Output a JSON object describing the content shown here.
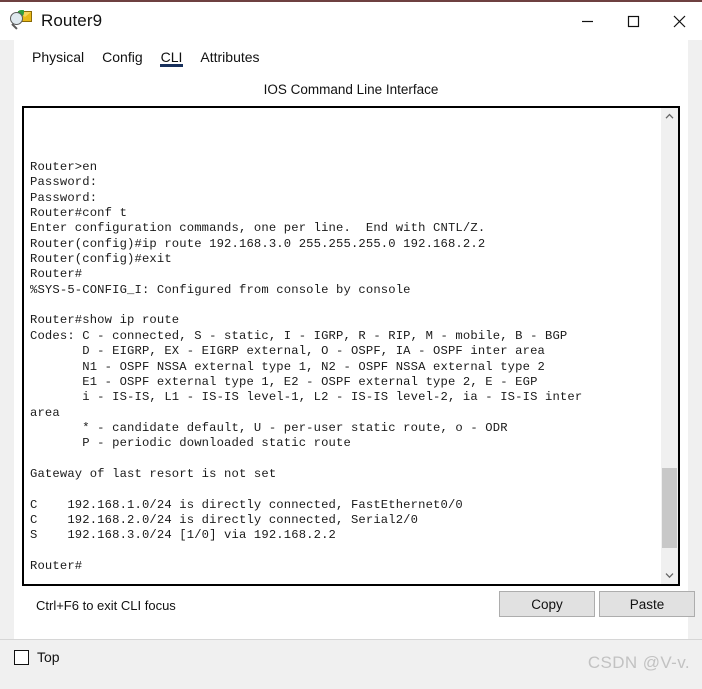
{
  "window": {
    "title": "Router9",
    "icon": "router-magnifier-icon",
    "controls": {
      "minimize": "minimize-icon",
      "maximize": "maximize-icon",
      "close": "close-icon"
    }
  },
  "tabs": [
    {
      "label": "Physical",
      "active": false
    },
    {
      "label": "Config",
      "active": false
    },
    {
      "label": "CLI",
      "active": true
    },
    {
      "label": "Attributes",
      "active": false
    }
  ],
  "panel": {
    "title": "IOS Command Line Interface"
  },
  "terminal": {
    "content": "\n\n\nRouter>en\nPassword:\nPassword:\nRouter#conf t\nEnter configuration commands, one per line.  End with CNTL/Z.\nRouter(config)#ip route 192.168.3.0 255.255.255.0 192.168.2.2\nRouter(config)#exit\nRouter#\n%SYS-5-CONFIG_I: Configured from console by console\n\nRouter#show ip route\nCodes: C - connected, S - static, I - IGRP, R - RIP, M - mobile, B - BGP\n       D - EIGRP, EX - EIGRP external, O - OSPF, IA - OSPF inter area\n       N1 - OSPF NSSA external type 1, N2 - OSPF NSSA external type 2\n       E1 - OSPF external type 1, E2 - OSPF external type 2, E - EGP\n       i - IS-IS, L1 - IS-IS level-1, L2 - IS-IS level-2, ia - IS-IS inter\narea\n       * - candidate default, U - per-user static route, o - ODR\n       P - periodic downloaded static route\n\nGateway of last resort is not set\n\nC    192.168.1.0/24 is directly connected, FastEthernet0/0\nC    192.168.2.0/24 is directly connected, Serial2/0\nS    192.168.3.0/24 [1/0] via 192.168.2.2\n\nRouter#",
    "scrollbar": {
      "up_arrow": "chevron-up-icon",
      "down_arrow": "chevron-down-icon"
    }
  },
  "footer": {
    "hint": "Ctrl+F6 to exit CLI focus",
    "copy_label": "Copy",
    "paste_label": "Paste"
  },
  "bottom": {
    "top_checkbox_label": "Top",
    "top_checked": false,
    "watermark": "CSDN @V-v."
  },
  "colors": {
    "accent": "#18305c",
    "titlebar_accent": "#6e4040",
    "panel_bg": "#ffffff",
    "window_bg": "#f0f0f0",
    "button_bg": "#e1e1e1",
    "scroll_thumb": "#c8c8c8"
  }
}
